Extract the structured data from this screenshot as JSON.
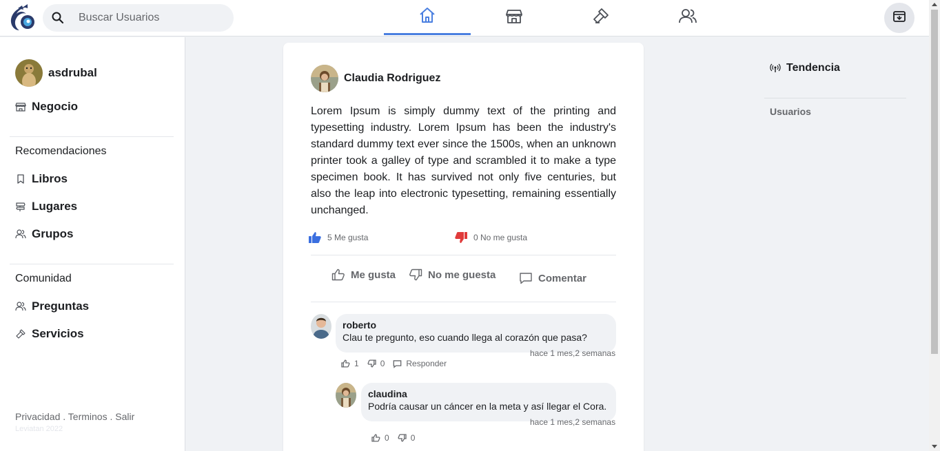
{
  "search": {
    "placeholder": "Buscar Usuarios"
  },
  "nav": {
    "tabs": [
      {
        "icon": "home-icon",
        "active": true
      },
      {
        "icon": "store-icon",
        "active": false
      },
      {
        "icon": "hammer-icon",
        "active": false
      },
      {
        "icon": "users-icon",
        "active": false
      }
    ],
    "right_button_icon": "archive-icon"
  },
  "sidebar": {
    "user_name": "asdrubal",
    "business_label": "Negocio",
    "recommendations_heading": "Recomendaciones",
    "recommendations": [
      {
        "label": "Libros",
        "icon": "bookmark-icon"
      },
      {
        "label": "Lugares",
        "icon": "signpost-icon"
      },
      {
        "label": "Grupos",
        "icon": "group-icon"
      }
    ],
    "community_heading": "Comunidad",
    "community": [
      {
        "label": "Preguntas",
        "icon": "question-group-icon"
      },
      {
        "label": "Servicios",
        "icon": "hammer-icon"
      }
    ],
    "footer": {
      "privacy": "Privacidad",
      "terms": "Terminos",
      "logout": "Salir",
      "separator": " . ",
      "copyright": "Leviatan 2022"
    }
  },
  "post": {
    "author": "Claudia Rodriguez",
    "body": "Lorem Ipsum is simply dummy text of the printing and typesetting industry. Lorem Ipsum has been the industry's standard dummy text ever since the 1500s, when an unknown printer took a galley of type and scrambled it to make a type specimen book. It has survived not only five centuries, but also the leap into electronic typesetting, remaining essentially unchanged.",
    "likes_text": "5 Me gusta",
    "dislikes_text": "0 No me gusta",
    "actions": {
      "like": "Me gusta",
      "dislike": "No me guesta",
      "comment": "Comentar"
    },
    "comments": [
      {
        "name": "roberto",
        "text": "Clau te pregunto, eso cuando llega al corazón que pasa?",
        "time": "hace 1 mes,2 semanas",
        "likes": "1",
        "dislikes": "0",
        "reply": "Responder"
      },
      {
        "name": "claudina",
        "text": "Podría causar un cáncer en la meta y así llegar el Cora.",
        "time": "hace 1 mes,2 semanas",
        "likes": "0",
        "dislikes": "0"
      }
    ]
  },
  "rightbar": {
    "trending": "Tendencia",
    "users": "Usuarios"
  },
  "colors": {
    "accent": "#4a7fe0",
    "like": "#3b6fe0",
    "dislike": "#e03b3b"
  }
}
